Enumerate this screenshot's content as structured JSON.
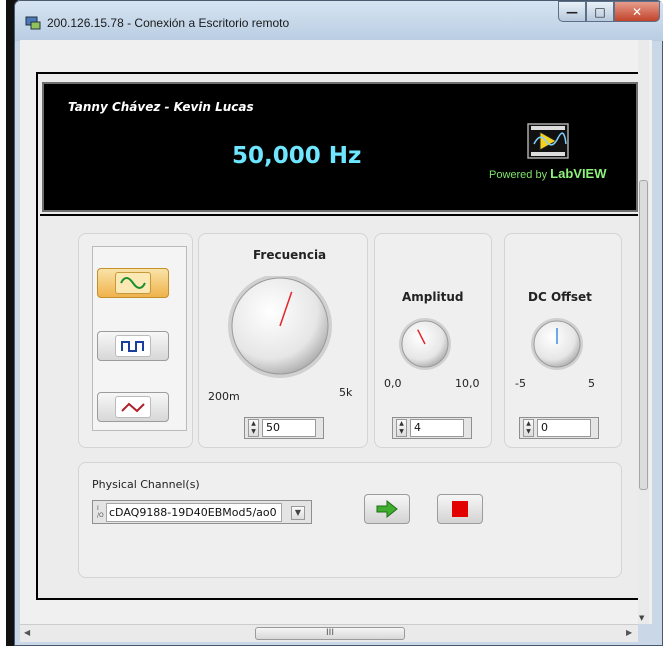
{
  "window": {
    "title": "200.126.15.78 - Conexión a Escritorio remoto",
    "min_glyph": "—",
    "max_glyph": "□",
    "close_glyph": "✕",
    "icon": "remote-desktop-icon"
  },
  "banner": {
    "authors": "Tanny Chávez - Kevin Lucas",
    "frequency_readout": "50,000 Hz",
    "powered_prefix": "Powered by ",
    "powered_brand": "LabVIEW",
    "logo": "labview-logo-icon"
  },
  "waveform_selector": {
    "options": [
      {
        "icon": "sine-wave-icon",
        "selected": true
      },
      {
        "icon": "square-wave-icon",
        "selected": false
      },
      {
        "icon": "triangle-wave-icon",
        "selected": false
      }
    ]
  },
  "frecuencia": {
    "title": "Frecuencia",
    "min_label": "200m",
    "max_label": "5k",
    "value": "50",
    "knob_fraction": 0.57
  },
  "amplitud": {
    "title": "Amplitud",
    "min_label": "0,0",
    "max_label": "10,0",
    "value": "4",
    "knob_fraction": 0.4
  },
  "dc_offset": {
    "title": "DC Offset",
    "min_label": "-5",
    "max_label": "5",
    "value": "0",
    "knob_fraction": 0.5
  },
  "channel": {
    "label": "Physical Channel(s)",
    "value": "cDAQ9188-19D40EBMod5/ao0",
    "io_glyph": "I/O"
  },
  "controls": {
    "run_icon": "run-arrow-icon",
    "stop_icon": "stop-icon"
  },
  "scrollbar": {
    "grip": "III"
  },
  "colors": {
    "readout": "#6fe6ff",
    "powered": "#7fe36b",
    "needle": "#e3262b",
    "offset_needle": "#3a8fe0",
    "stop": "#e30000",
    "run": "#3fae2e",
    "selected_mode": "#f0b24b"
  }
}
